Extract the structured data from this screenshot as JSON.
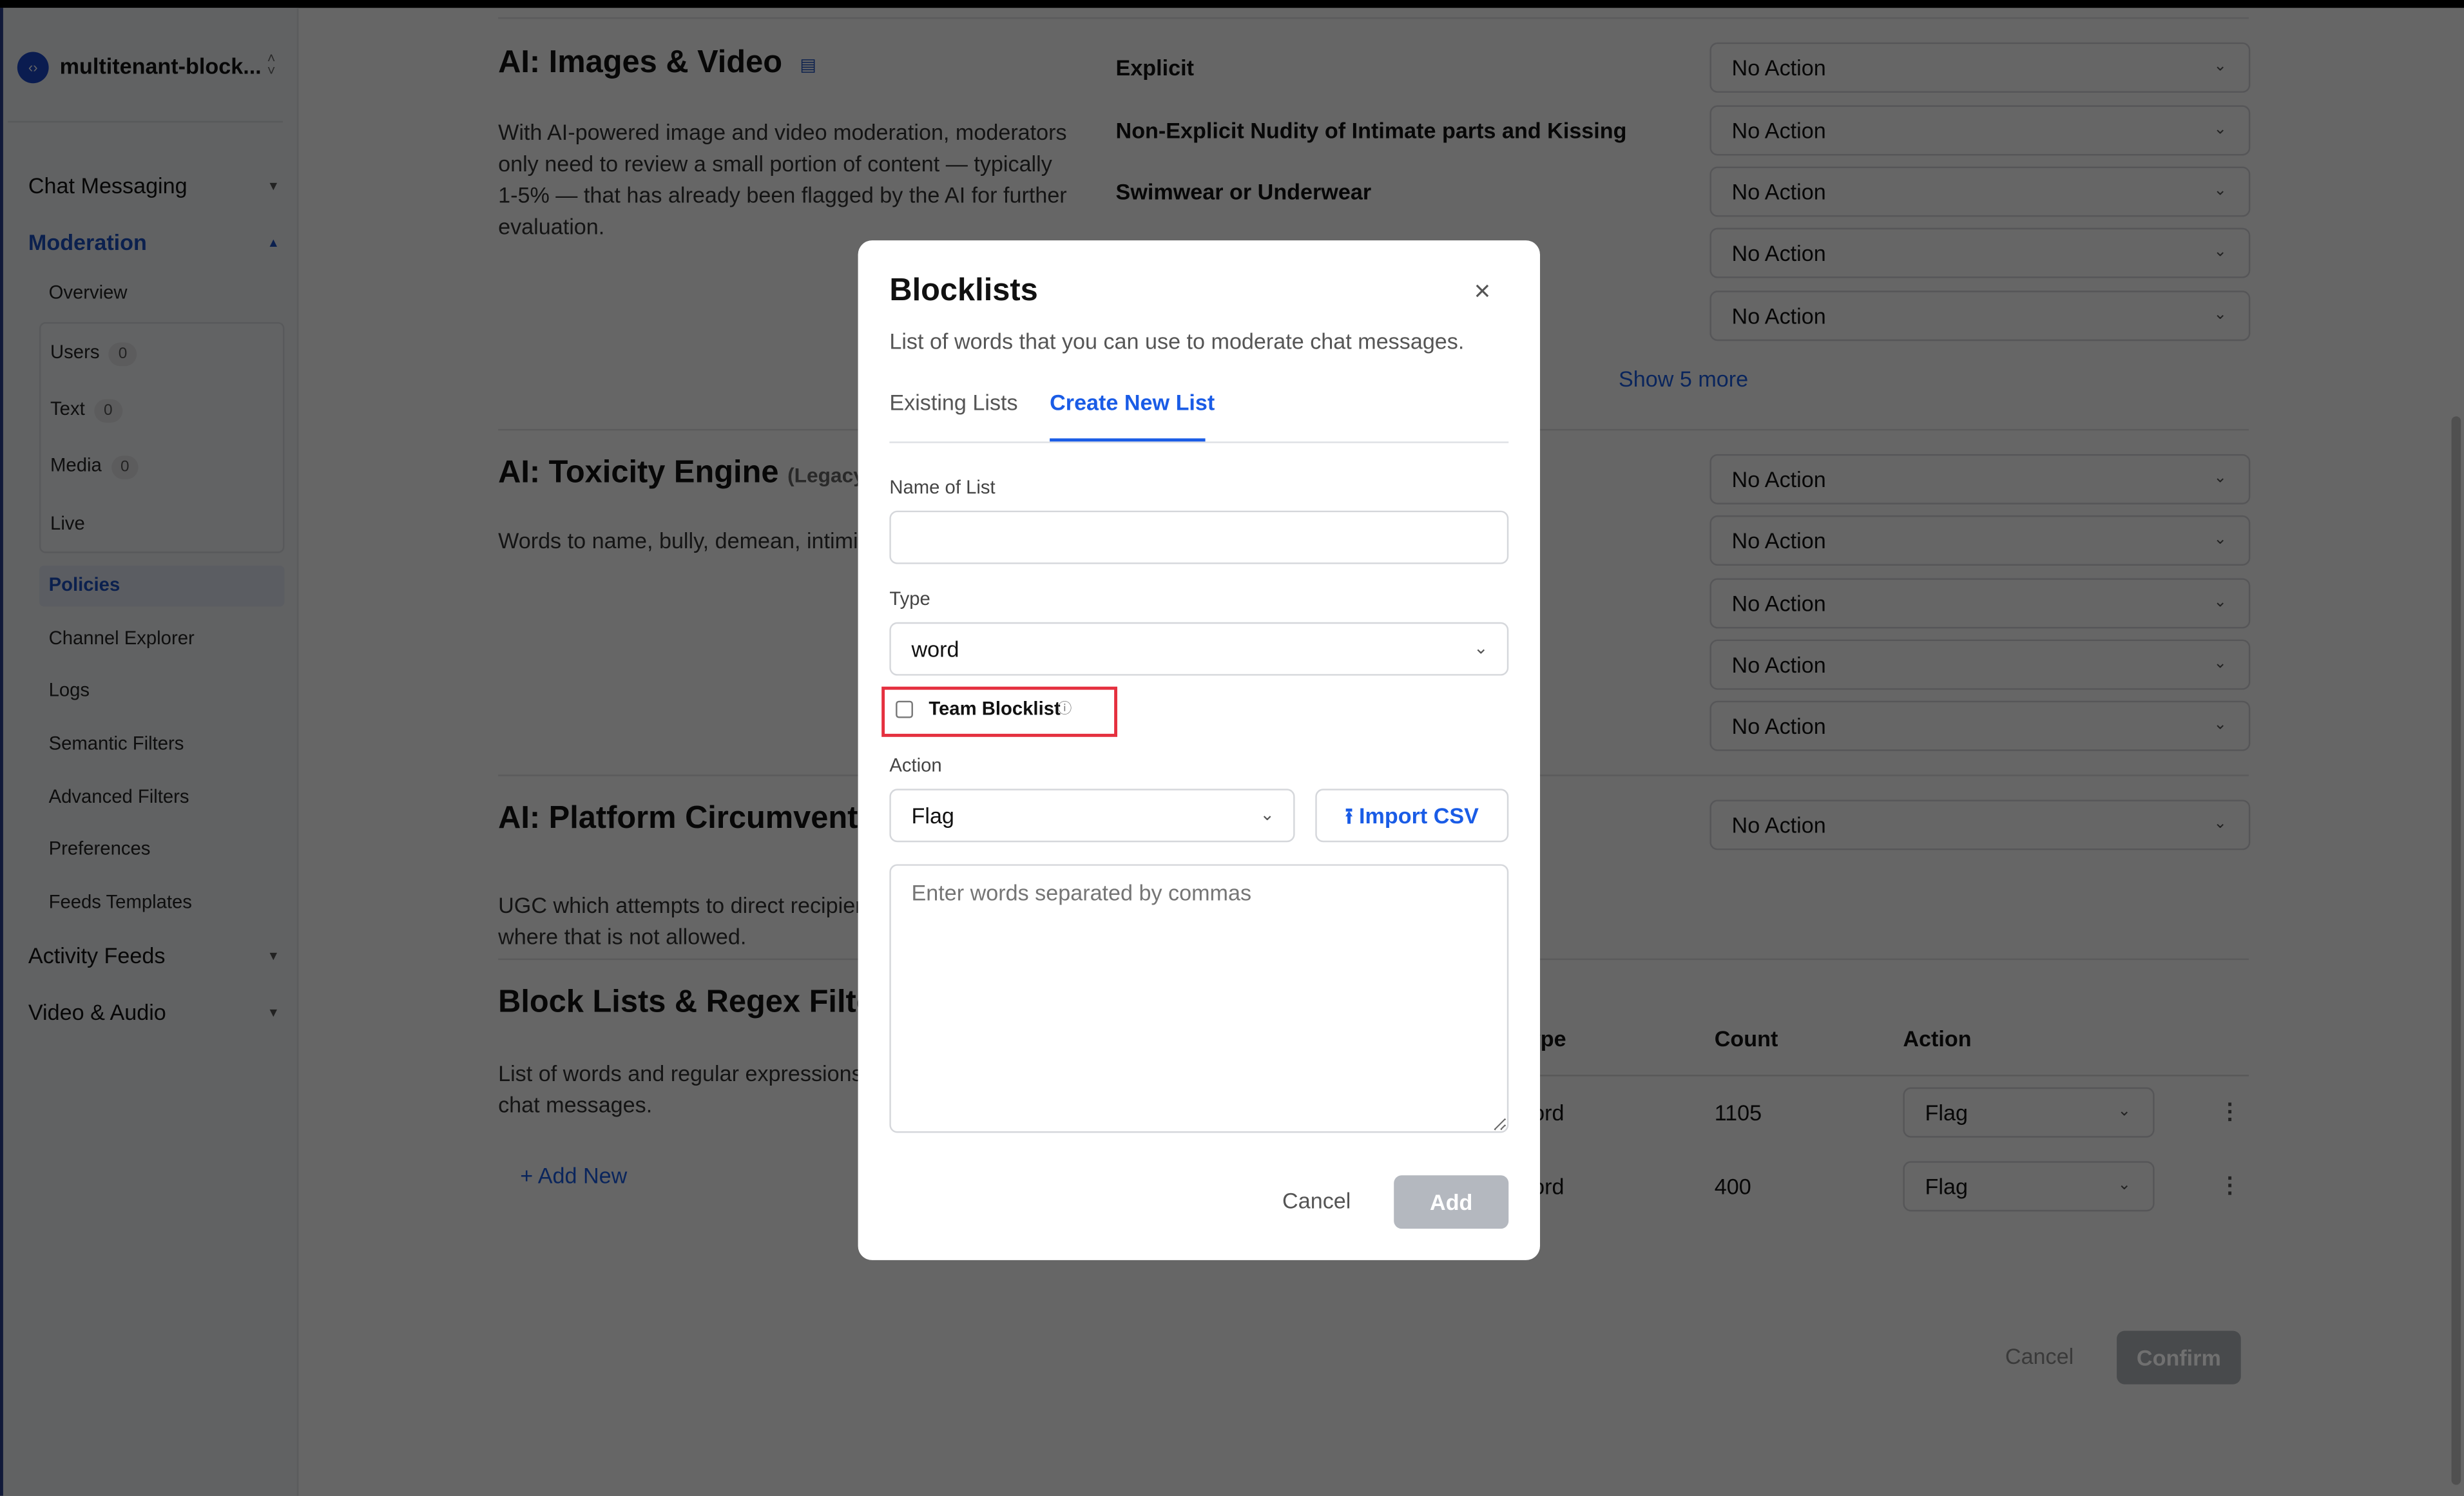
{
  "sidebar": {
    "app_name": "multitenant-block...",
    "items": [
      {
        "label": "Chat Messaging"
      },
      {
        "label": "Moderation"
      },
      {
        "label": "Overview"
      },
      {
        "label": "Users",
        "count": "0"
      },
      {
        "label": "Text",
        "count": "0"
      },
      {
        "label": "Media",
        "count": "0"
      },
      {
        "label": "Live"
      },
      {
        "label": "Policies"
      },
      {
        "label": "Channel Explorer"
      },
      {
        "label": "Logs"
      },
      {
        "label": "Semantic Filters"
      },
      {
        "label": "Advanced Filters"
      },
      {
        "label": "Preferences"
      },
      {
        "label": "Feeds Templates"
      },
      {
        "label": "Activity Feeds"
      },
      {
        "label": "Video & Audio"
      }
    ]
  },
  "sections": {
    "images": {
      "title": "AI: Images & Video",
      "desc": "With AI-powered image and video moderation, moderators only need to review a small portion of content — typically 1-5% — that has already been flagged by the AI for further evaluation.",
      "rules": [
        "Explicit",
        "Non-Explicit Nudity of Intimate parts and Kissing",
        "Swimwear or Underwear"
      ],
      "action": "No Action",
      "show_more": "Show 5 more"
    },
    "toxicity": {
      "title": "AI: Toxicity Engine",
      "tag": "(Legacy)",
      "desc": "Words to name, bully, demean, intimidate another person.",
      "action": "No Action"
    },
    "circumvention": {
      "title": "AI: Platform Circumvention",
      "desc": "UGC which attempts to direct recipients to situations where that is not allowed.",
      "action": "No Action"
    },
    "blocklists": {
      "title": "Block Lists & Regex Filters",
      "desc": "List of words and regular expressions to moderate chat messages.",
      "add_new": "+ Add New",
      "columns": [
        "Type",
        "Count",
        "Action"
      ],
      "rows": [
        {
          "type": "word",
          "count": "1105",
          "action": "Flag"
        },
        {
          "type": "word",
          "count": "400",
          "action": "Flag"
        }
      ]
    }
  },
  "footer": {
    "cancel": "Cancel",
    "confirm": "Confirm"
  },
  "modal": {
    "title": "Blocklists",
    "subtitle": "List of words that you can use to moderate chat messages.",
    "tabs": [
      "Existing Lists",
      "Create New List"
    ],
    "active_tab": "Create New List",
    "name_label": "Name of List",
    "name_value": "",
    "type_label": "Type",
    "type_value": "word",
    "team_label": "Team Blocklist",
    "team_checked": false,
    "action_label": "Action",
    "action_value": "Flag",
    "import_csv": "Import CSV",
    "words_placeholder": "Enter words separated by commas",
    "cancel": "Cancel",
    "add": "Add"
  },
  "colors": {
    "accent": "#1a5ce6",
    "highlight": "#e5303f",
    "add_disabled": "#b4b8bf"
  }
}
